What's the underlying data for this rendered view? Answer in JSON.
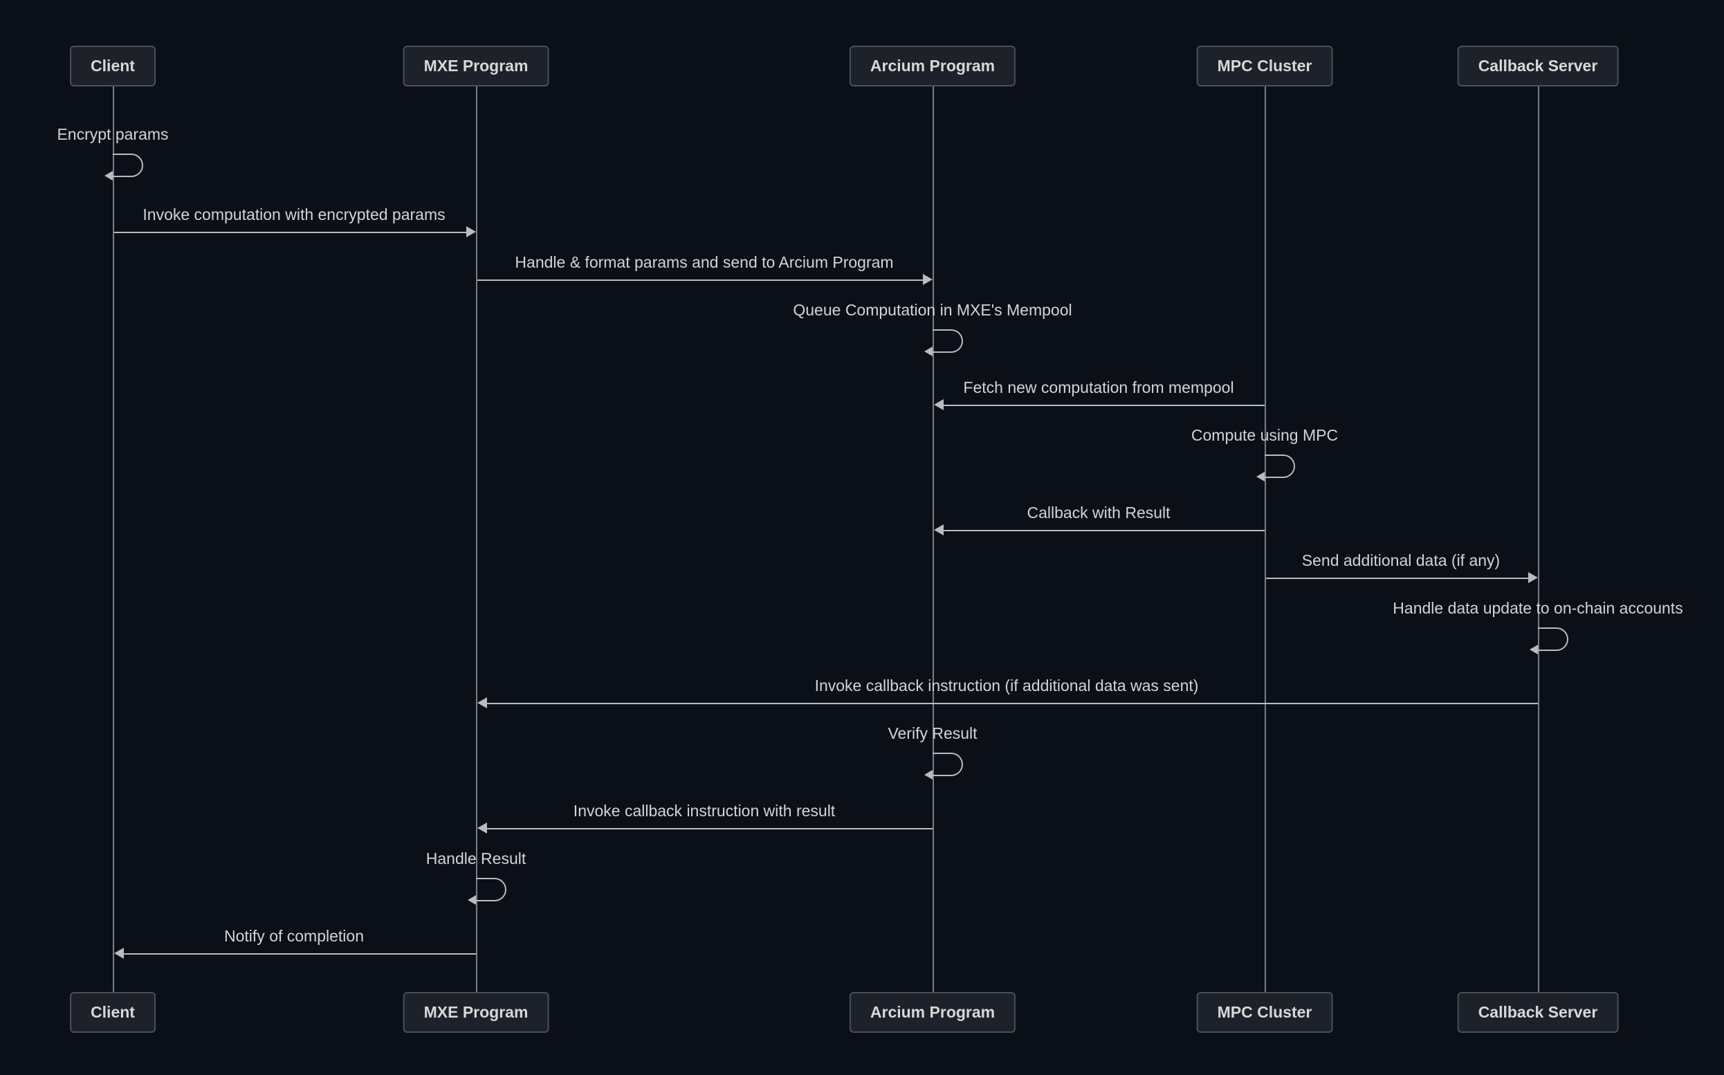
{
  "actors": {
    "a0": "Client",
    "a1": "MXE Program",
    "a2": "Arcium Program",
    "a3": "MPC Cluster",
    "a4": "Callback Server"
  },
  "messages": {
    "m0": "Encrypt params",
    "m1": "Invoke computation with encrypted params",
    "m2": "Handle & format params and send to Arcium Program",
    "m3": "Queue Computation in MXE's Mempool",
    "m4": "Fetch new computation from mempool",
    "m5": "Compute using MPC",
    "m6": "Callback with Result",
    "m7": "Send additional data (if any)",
    "m8": "Handle data update to on-chain accounts",
    "m9": "Invoke callback instruction (if additional data was sent)",
    "m10": "Verify Result",
    "m11": "Invoke callback instruction with result",
    "m12": "Handle Result",
    "m13": "Notify of completion"
  },
  "chart_data": {
    "type": "sequence-diagram",
    "actors": [
      "Client",
      "MXE Program",
      "Arcium Program",
      "MPC Cluster",
      "Callback Server"
    ],
    "steps": [
      {
        "from": "Client",
        "to": "Client",
        "label": "Encrypt params",
        "self": true
      },
      {
        "from": "Client",
        "to": "MXE Program",
        "label": "Invoke computation with encrypted params",
        "self": false
      },
      {
        "from": "MXE Program",
        "to": "Arcium Program",
        "label": "Handle & format params and send to Arcium Program",
        "self": false
      },
      {
        "from": "Arcium Program",
        "to": "Arcium Program",
        "label": "Queue Computation in MXE's Mempool",
        "self": true
      },
      {
        "from": "MPC Cluster",
        "to": "Arcium Program",
        "label": "Fetch new computation from mempool",
        "self": false
      },
      {
        "from": "MPC Cluster",
        "to": "MPC Cluster",
        "label": "Compute using MPC",
        "self": true
      },
      {
        "from": "MPC Cluster",
        "to": "Arcium Program",
        "label": "Callback with Result",
        "self": false
      },
      {
        "from": "MPC Cluster",
        "to": "Callback Server",
        "label": "Send additional data (if any)",
        "self": false
      },
      {
        "from": "Callback Server",
        "to": "Callback Server",
        "label": "Handle data update to on-chain accounts",
        "self": true
      },
      {
        "from": "Callback Server",
        "to": "MXE Program",
        "label": "Invoke callback instruction (if additional data was sent)",
        "self": false
      },
      {
        "from": "Arcium Program",
        "to": "Arcium Program",
        "label": "Verify Result",
        "self": true
      },
      {
        "from": "Arcium Program",
        "to": "MXE Program",
        "label": "Invoke callback instruction with result",
        "self": false
      },
      {
        "from": "MXE Program",
        "to": "MXE Program",
        "label": "Handle Result",
        "self": true
      },
      {
        "from": "MXE Program",
        "to": "Client",
        "label": "Notify of completion",
        "self": false
      }
    ]
  }
}
